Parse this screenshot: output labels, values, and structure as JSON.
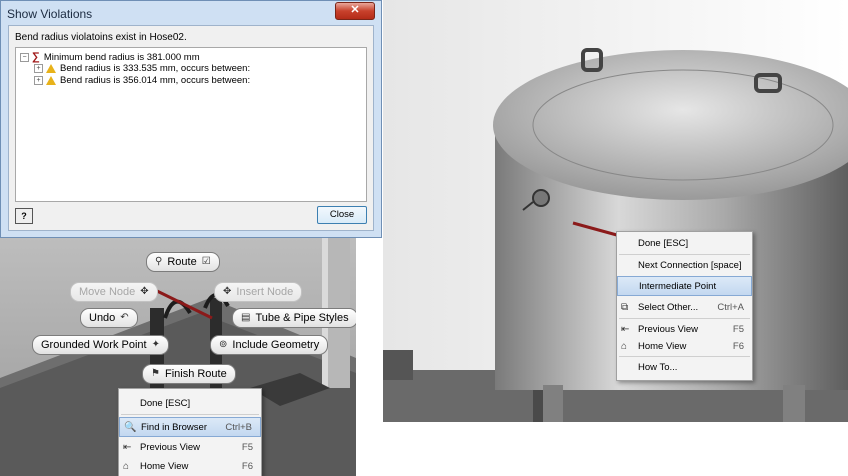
{
  "dialog": {
    "title": "Show Violations",
    "close_x": "✕",
    "message": "Bend radius violatoins exist in Hose02.",
    "tree": [
      {
        "expander": "⊟",
        "label": "Minimum bend radius is 381.000 mm",
        "type": "root"
      },
      {
        "expander": "⊞",
        "label": "Bend radius is 333.535 mm, occurs between:",
        "type": "warning"
      },
      {
        "expander": "⊞",
        "label": "Bend radius is 356.014 mm, occurs between:",
        "type": "warning"
      }
    ],
    "help_label": "?",
    "close_label": "Close"
  },
  "marking_menu": {
    "route": "Route",
    "move_node": "Move Node",
    "insert_node": "Insert Node",
    "undo": "Undo",
    "tube_pipe_styles": "Tube & Pipe Styles",
    "grounded_work_point": "Grounded Work Point",
    "include_geometry": "Include Geometry",
    "finish_route": "Finish Route"
  },
  "left_context_menu": [
    {
      "label": "Done [ESC]",
      "shortcut": "",
      "icon": ""
    },
    {
      "label": "Find in Browser",
      "shortcut": "Ctrl+B",
      "icon": "find-in-browser-icon",
      "highlight": true
    },
    {
      "label": "Previous View",
      "shortcut": "F5",
      "icon": "previous-view-icon"
    },
    {
      "label": "Home View",
      "shortcut": "F6",
      "icon": "home-view-icon"
    }
  ],
  "right_context_menu": [
    {
      "label": "Done [ESC]",
      "shortcut": "",
      "icon": ""
    },
    {
      "label": "Next Connection [space]",
      "shortcut": "",
      "icon": ""
    },
    {
      "label": "Intermediate Point",
      "shortcut": "",
      "icon": "",
      "highlight": true
    },
    {
      "label": "Select Other...",
      "shortcut": "Ctrl+A",
      "icon": "select-other-icon"
    },
    {
      "label": "Previous View",
      "shortcut": "F5",
      "icon": "previous-view-icon"
    },
    {
      "label": "Home View",
      "shortcut": "F6",
      "icon": "home-view-icon"
    },
    {
      "label": "How To...",
      "shortcut": "",
      "icon": ""
    }
  ],
  "colors": {
    "highlight": "#c3d8f0",
    "route_line": "#8b1a1a",
    "warning": "#e8b21a"
  }
}
